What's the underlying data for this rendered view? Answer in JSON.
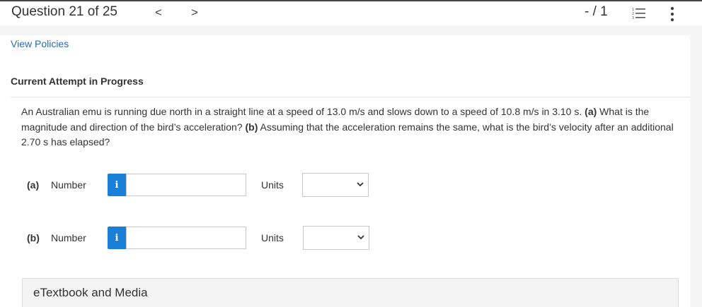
{
  "header": {
    "question_counter": "Question 21 of 25",
    "prev_arrow": "<",
    "next_arrow": ">",
    "score": "- / 1"
  },
  "links": {
    "view_policies": "View Policies"
  },
  "attempt_heading": "Current Attempt in Progress",
  "question": {
    "text_1": "An Australian emu is running due north in a straight line at a speed of 13.0 m/s and slows down to a speed of 10.8 m/s in 3.10 s.",
    "part_a_marker": "(a)",
    "text_2": "What is the magnitude and direction of the bird’s acceleration?",
    "part_b_marker": "(b)",
    "text_3": "Assuming that the acceleration remains the same, what is the bird’s velocity after an additional 2.70 s has elapsed?"
  },
  "answers": [
    {
      "part": "(a)",
      "number_label": "Number",
      "info": "i",
      "value": "",
      "units_label": "Units",
      "unit_selected": ""
    },
    {
      "part": "(b)",
      "number_label": "Number",
      "info": "i",
      "value": "",
      "units_label": "Units",
      "unit_selected": ""
    }
  ],
  "etextbook": {
    "label": "eTextbook and Media"
  },
  "icons": {
    "info_color": "#1a7fd6",
    "link_color": "#2a6bb5"
  }
}
